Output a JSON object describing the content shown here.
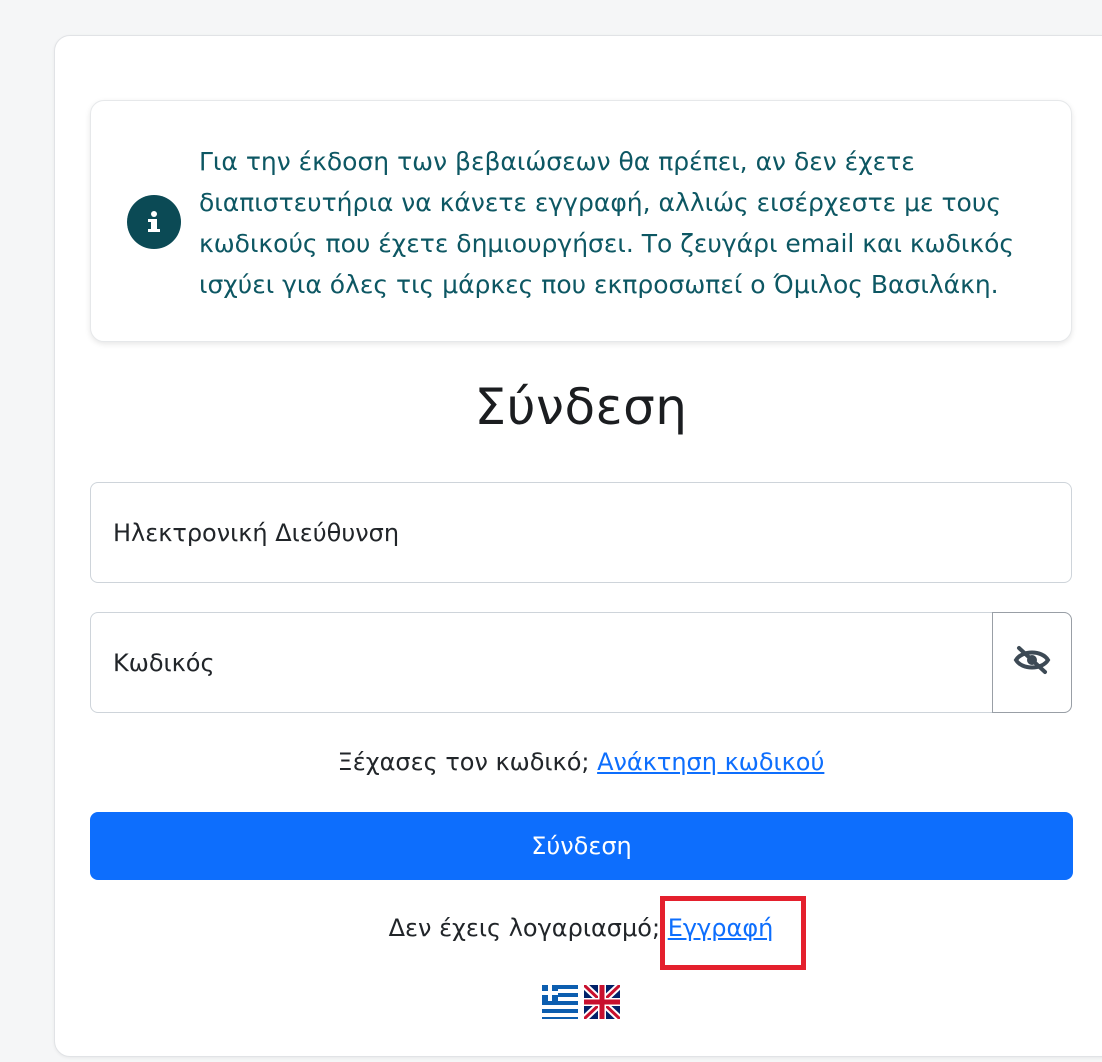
{
  "info": {
    "icon": "info-circle-icon",
    "text": "Για την έκδοση των βεβαιώσεων θα πρέπει, αν δεν έχετε διαπιστευτήρια να κάνετε εγγραφή, αλλιώς εισέρχεστε με τους κωδικούς που έχετε δημιουργήσει. Το ζευγάρι email και κωδικός ισχύει για όλες τις μάρκες που εκπροσωπεί ο Όμιλος Βασιλάκη."
  },
  "login": {
    "title": "Σύνδεση",
    "email_placeholder": "Ηλεκτρονική Διεύθυνση",
    "password_placeholder": "Κωδικός",
    "toggle_icon": "eye-slash-icon",
    "forgot_text": "Ξέχασες τον κωδικό;",
    "forgot_link": "Ανάκτηση κωδικού",
    "submit_label": "Σύνδεση",
    "register_text": "Δεν έχεις λογαριασμό;",
    "register_link": "Εγγραφή"
  },
  "languages": [
    {
      "flag": "greece-flag-icon"
    },
    {
      "flag": "uk-flag-icon"
    }
  ],
  "colors": {
    "accent": "#0d6efd",
    "info_text": "#0d5763",
    "info_icon_bg": "#0b4a55",
    "highlight": "#e4202d"
  }
}
